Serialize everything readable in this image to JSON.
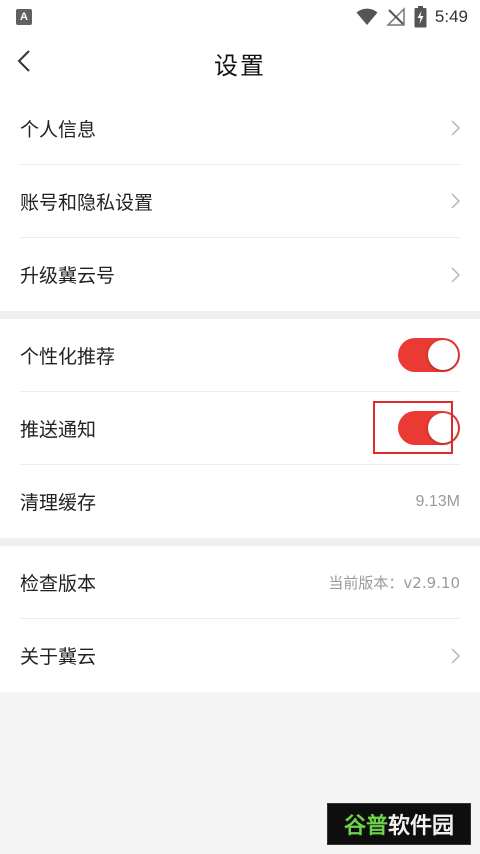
{
  "status_bar": {
    "app_badge": "A",
    "time": "5:49",
    "icons": [
      "wifi-icon",
      "no-signal-icon",
      "battery-charging-icon"
    ]
  },
  "header": {
    "title": "设置",
    "back_icon": "chevron-left-icon"
  },
  "groups": [
    {
      "rows": [
        {
          "label": "个人信息",
          "accessory": "chevron"
        },
        {
          "label": "账号和隐私设置",
          "accessory": "chevron"
        },
        {
          "label": "升级冀云号",
          "accessory": "chevron"
        }
      ]
    },
    {
      "rows": [
        {
          "label": "个性化推荐",
          "accessory": "toggle",
          "toggle_on": true
        },
        {
          "label": "推送通知",
          "accessory": "toggle",
          "toggle_on": true
        },
        {
          "label": "清理缓存",
          "accessory": "value",
          "value": "9.13M"
        }
      ]
    },
    {
      "rows": [
        {
          "label": "检查版本",
          "accessory": "value",
          "value": "当前版本：v2.9.10"
        },
        {
          "label": "关于冀云",
          "accessory": "chevron"
        }
      ]
    }
  ],
  "colors": {
    "accent": "#ea3a33",
    "highlight_border": "#e02a2a",
    "background": "#f4f4f4"
  },
  "watermark": {
    "part_a": "谷普",
    "part_b": "软件园"
  }
}
